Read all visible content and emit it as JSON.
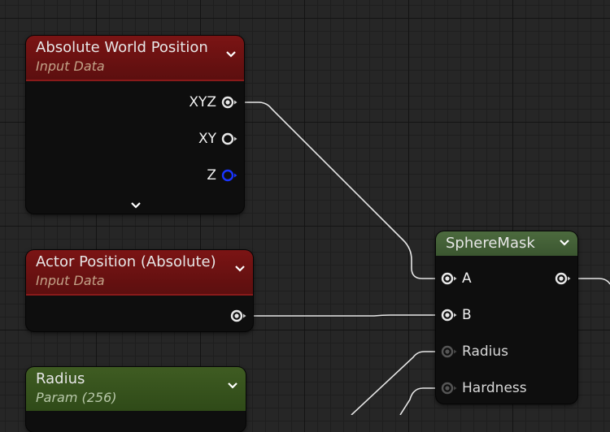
{
  "colors": {
    "canvas_bg": "#262626",
    "node_body": "#0e0e0e",
    "input_data_header": "#6b1212",
    "param_header": "#3f5c22",
    "spheremask_header": "#435f37",
    "wire": "#e6e6e6",
    "pin_z": "#1a35ff",
    "pin_inactive": "#555555"
  },
  "nodes": {
    "absolute_world_position": {
      "title": "Absolute World Position",
      "subtitle": "Input Data",
      "outputs": [
        {
          "label": "XYZ",
          "icon": "pin-connected-icon"
        },
        {
          "label": "XY",
          "icon": "pin-open-icon"
        },
        {
          "label": "Z",
          "icon": "pin-blue-icon"
        }
      ],
      "expand_icon": "chevron-down-icon"
    },
    "actor_position": {
      "title": "Actor Position (Absolute)",
      "subtitle": "Input Data",
      "outputs": [
        {
          "label": "",
          "icon": "pin-connected-icon"
        }
      ]
    },
    "radius_param": {
      "title": "Radius",
      "subtitle": "Param (256)"
    },
    "sphere_mask": {
      "title": "SphereMask",
      "inputs": [
        {
          "label": "A",
          "icon": "pin-connected-icon"
        },
        {
          "label": "B",
          "icon": "pin-connected-icon"
        },
        {
          "label": "Radius",
          "icon": "pin-inactive-icon"
        },
        {
          "label": "Hardness",
          "icon": "pin-inactive-icon"
        }
      ],
      "outputs": [
        {
          "label": "",
          "icon": "pin-connected-icon"
        }
      ]
    }
  }
}
